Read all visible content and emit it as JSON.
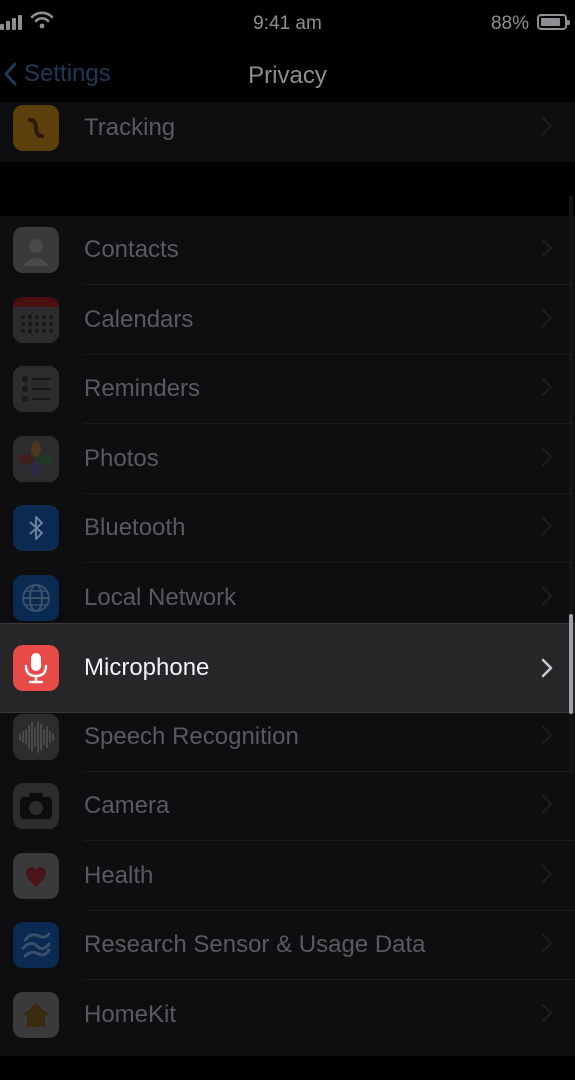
{
  "status_bar": {
    "time": "9:41 am",
    "battery": "88%",
    "battery_level": 0.88
  },
  "nav": {
    "back_label": "Settings",
    "title": "Privacy"
  },
  "top_row": {
    "label": "Tracking",
    "icon": "tracking-icon",
    "icon_color": "#5c3f0a"
  },
  "rows": [
    {
      "label": "Contacts",
      "icon": "contacts-icon",
      "icon_color": "#3a3a3c"
    },
    {
      "label": "Calendars",
      "icon": "calendar-icon",
      "icon_color": "#3a3a3c"
    },
    {
      "label": "Reminders",
      "icon": "reminders-icon",
      "icon_color": "#3a3a3c"
    },
    {
      "label": "Photos",
      "icon": "photos-icon",
      "icon_color": "#3a3a3c"
    },
    {
      "label": "Bluetooth",
      "icon": "bluetooth-icon",
      "icon_color": "#0a2a52"
    },
    {
      "label": "Local Network",
      "icon": "globe-icon",
      "icon_color": "#0a2a52"
    },
    {
      "label": "Microphone",
      "icon": "microphone-icon",
      "icon_color": "#e84a48",
      "highlighted": true
    },
    {
      "label": "Speech Recognition",
      "icon": "waveform-icon",
      "icon_color": "#2c2c2e"
    },
    {
      "label": "Camera",
      "icon": "camera-icon",
      "icon_color": "#2c2c2e"
    },
    {
      "label": "Health",
      "icon": "heart-icon",
      "icon_color": "#3a3a3c"
    },
    {
      "label": "Research Sensor & Usage Data",
      "icon": "research-icon",
      "icon_color": "#0a2a52"
    },
    {
      "label": "HomeKit",
      "icon": "home-icon",
      "icon_color": "#3a3a3c"
    }
  ]
}
